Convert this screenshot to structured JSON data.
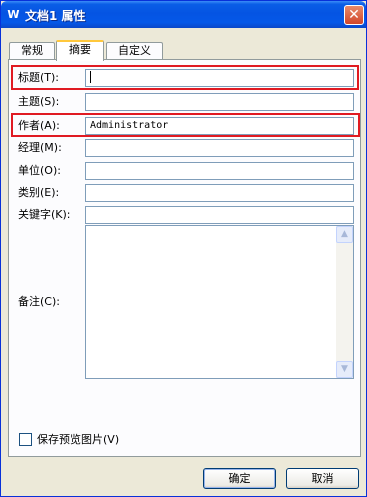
{
  "window": {
    "app_icon": "W",
    "title": "文档1 属性",
    "close_glyph": "✕"
  },
  "tabs": [
    {
      "label": "常规"
    },
    {
      "label": "摘要"
    },
    {
      "label": "自定义"
    }
  ],
  "active_tab": "摘要",
  "fields": {
    "title": {
      "label": "标题(T):",
      "value": ""
    },
    "subject": {
      "label": "主题(S):",
      "value": ""
    },
    "author": {
      "label": "作者(A):",
      "value": "Administrator"
    },
    "manager": {
      "label": "经理(M):",
      "value": ""
    },
    "company": {
      "label": "单位(O):",
      "value": ""
    },
    "category": {
      "label": "类别(E):",
      "value": ""
    },
    "keywords": {
      "label": "关键字(K):",
      "value": ""
    },
    "comments": {
      "label": "备注(C):",
      "value": ""
    }
  },
  "scroll_up_glyph": "▲",
  "scroll_down_glyph": "▼",
  "save_preview": {
    "label": "保存预览图片(V)",
    "checked": false
  },
  "buttons": {
    "ok": "确定",
    "cancel": "取消"
  },
  "colors": {
    "titlebar": "#0554e3",
    "highlight": "#e01a22",
    "dialog_bg": "#ece9d8"
  }
}
